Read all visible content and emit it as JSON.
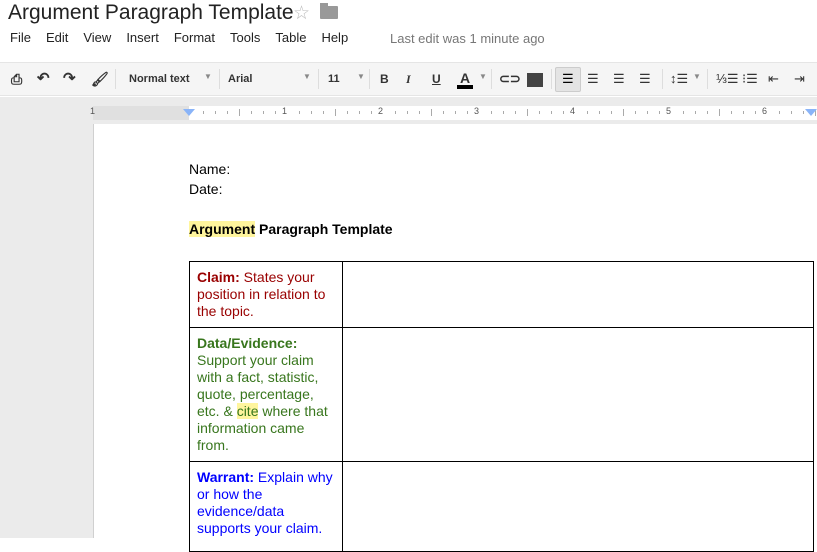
{
  "app": {
    "title": "Argument Paragraph Template",
    "star_icon": "star-icon",
    "folder_icon": "folder-icon"
  },
  "menu": [
    "File",
    "Edit",
    "View",
    "Insert",
    "Format",
    "Tools",
    "Table",
    "Help"
  ],
  "last_edit": "Last edit was 1 minute ago",
  "toolbar": {
    "style": "Normal text",
    "font": "Arial",
    "size": "11",
    "bold": "B",
    "italic": "I",
    "underline": "U",
    "text_color": "A"
  },
  "ruler": [
    "1",
    "1",
    "2",
    "3",
    "4",
    "5",
    "6"
  ],
  "doc": {
    "name": "Name:",
    "date": "Date:",
    "heading_highlight": "Argument",
    "heading_rest": " Paragraph Template",
    "rows": [
      {
        "label": "Claim:",
        "text": " States your position in relation to the topic.",
        "color": "#990000"
      },
      {
        "label": "Data/Evidence:",
        "text_before": "Support your claim with a fact, statistic, quote, percentage, etc. & ",
        "highlight": "cite",
        "text_after": " where that information came from.",
        "color": "#38761d"
      },
      {
        "label": "Warrant:",
        "text": " Explain why or how the evidence/data supports your claim.",
        "color": "#0000ff"
      }
    ]
  }
}
